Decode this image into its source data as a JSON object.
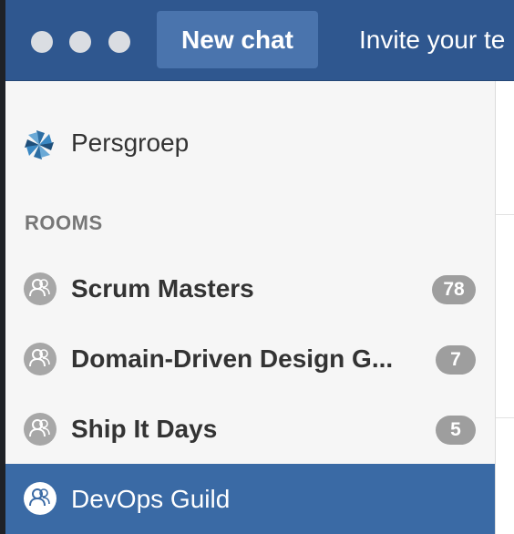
{
  "window": {
    "controls": [
      "close",
      "minimize",
      "maximize"
    ]
  },
  "topbar": {
    "new_chat_label": "New chat",
    "invite_label": "Invite your te"
  },
  "sidebar": {
    "organization": {
      "name": "Persgroep",
      "icon": "pinwheel-logo-icon"
    },
    "rooms_heading": "ROOMS",
    "rooms": [
      {
        "name": "Scrum Masters",
        "unread": "78",
        "icon": "room-avatar-icon",
        "selected": false
      },
      {
        "name": "Domain-Driven Design G...",
        "unread": "7",
        "icon": "room-avatar-icon",
        "selected": false
      },
      {
        "name": "Ship It Days",
        "unread": "5",
        "icon": "room-avatar-icon",
        "selected": false
      },
      {
        "name": "DevOps Guild",
        "unread": "",
        "icon": "room-avatar-icon",
        "selected": true
      }
    ]
  },
  "colors": {
    "topbar": "#2f578f",
    "new_chat_button": "#4a74ad",
    "selected_room": "#3a6aa5",
    "badge": "#9e9e9e",
    "sidebar_bg": "#f6f6f6"
  }
}
